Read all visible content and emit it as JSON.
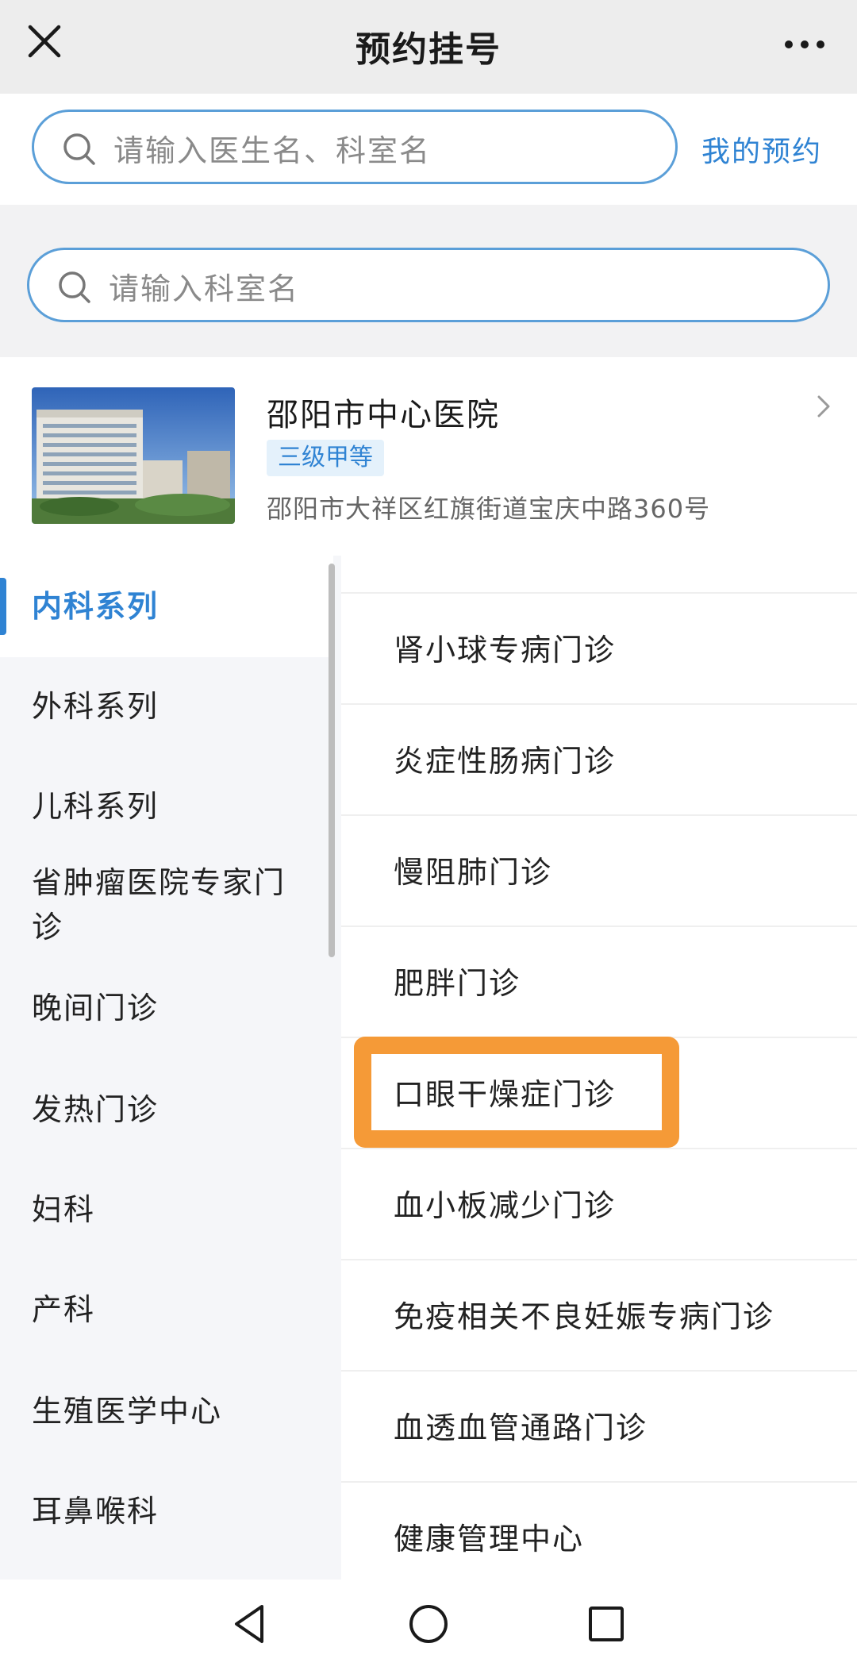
{
  "nav": {
    "title": "预约挂号"
  },
  "top_search": {
    "placeholder": "请输入医生名、科室名",
    "my_appointments": "我的预约"
  },
  "dept_search": {
    "placeholder": "请输入科室名"
  },
  "hospital": {
    "name": "邵阳市中心医院",
    "level": "三级甲等",
    "address": "邵阳市大祥区红旗街道宝庆中路360号"
  },
  "sidebar": {
    "items": [
      {
        "label": "内科系列",
        "active": true
      },
      {
        "label": "外科系列"
      },
      {
        "label": "儿科系列"
      },
      {
        "label": "省肿瘤医院专家门诊"
      },
      {
        "label": "晚间门诊"
      },
      {
        "label": "发热门诊"
      },
      {
        "label": "妇科"
      },
      {
        "label": "产科"
      },
      {
        "label": "生殖医学中心"
      },
      {
        "label": "耳鼻喉科"
      }
    ]
  },
  "departments": [
    {
      "label": "肾小球专病门诊"
    },
    {
      "label": "炎症性肠病门诊"
    },
    {
      "label": "慢阻肺门诊"
    },
    {
      "label": "肥胖门诊"
    },
    {
      "label": "口眼干燥症门诊",
      "highlighted": true
    },
    {
      "label": "血小板减少门诊"
    },
    {
      "label": "免疫相关不良妊娠专病门诊"
    },
    {
      "label": "血透血管通路门诊"
    },
    {
      "label": "健康管理中心"
    }
  ],
  "colors": {
    "accent": "#2f83d3",
    "highlight": "#f59a37"
  }
}
